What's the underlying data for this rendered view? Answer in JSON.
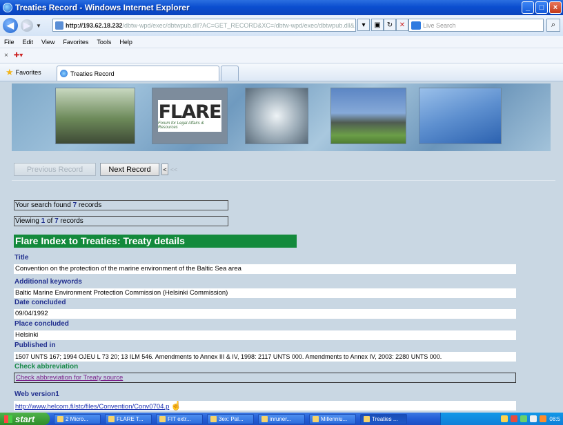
{
  "window": {
    "title": "Treaties Record - Windows Internet Explorer",
    "controls": [
      "minimize",
      "maximize",
      "close"
    ]
  },
  "addressbar": {
    "host": "http://193.62.18.232",
    "path": "/dbtw-wpd/exec/dbtwpub.dll?AC=GET_RECORD&XC=/dbtw-wpd/exec/dbtwpub.dll&",
    "search_placeholder": "Live Search"
  },
  "menu": [
    "File",
    "Edit",
    "View",
    "Favorites",
    "Tools",
    "Help"
  ],
  "favorites": {
    "label": "Favorites",
    "tab_label": "Treaties Record"
  },
  "banner": {
    "logo_text": "FLARE",
    "logo_tagline": "Forum for Legal Affairs & Resources"
  },
  "nav": {
    "previous_label": "Previous Record",
    "next_label": "Next Record",
    "first_glyph": "<",
    "first_dim_glyph": "<<"
  },
  "results": {
    "found_prefix": "Your search found ",
    "found_count": "7",
    "found_suffix": " records",
    "viewing_prefix": "Viewing ",
    "viewing_index": "1",
    "viewing_of": " of ",
    "viewing_total": "7",
    "viewing_suffix": " records"
  },
  "heading": "Flare Index to Treaties: Treaty details",
  "record": {
    "title_label": "Title",
    "title_value": "Convention on the protection of the marine environment of the Baltic Sea area",
    "keywords_label": "Additional keywords",
    "keywords_value": "Baltic Marine Environment Protection Commission (Helsinki Commission)",
    "date_label": "Date concluded",
    "date_value": "09/04/1992",
    "place_label": "Place concluded",
    "place_value": "Helsinki",
    "published_label": "Published in",
    "published_value": "1507 UNTS 167; 1994 OJEU L 73 20; 13 ILM 546. Amendments to Annex III & IV, 1998: 2117 UNTS 000. Amendments to Annex IV, 2003: 2280 UNTS 000.",
    "check_label": "Check abbreviation",
    "check_link": "Check abbreviation for Treaty source",
    "web_label": "Web version1",
    "web_link": "http://www.helcom.fi/stc/files/Convention/Conv0704.p"
  },
  "taskbar": {
    "start_label": "start",
    "items": [
      "2 Micro...",
      "FLARE T...",
      "FIT extr...",
      "3ex: Pal...",
      "inruner...",
      "Millenniu...",
      "Treaties ..."
    ],
    "clock": "08:5"
  }
}
